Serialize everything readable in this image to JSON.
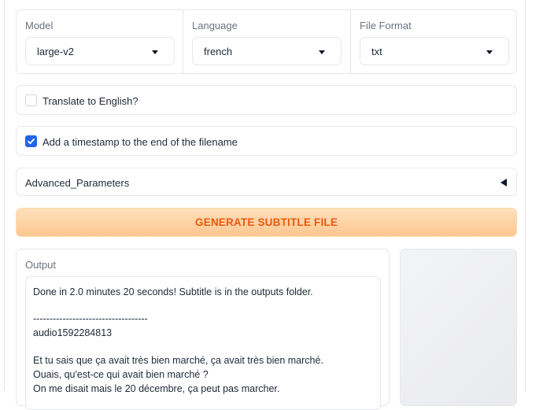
{
  "model": {
    "label": "Model",
    "value": "large-v2"
  },
  "language": {
    "label": "Language",
    "value": "french"
  },
  "file_format": {
    "label": "File Format",
    "value": "txt"
  },
  "translate": {
    "label": "Translate to English?",
    "checked": false
  },
  "timestamp": {
    "label": "Add a timestamp to the end of the filename",
    "checked": true
  },
  "advanced": {
    "label": "Advanced_Parameters"
  },
  "generate": {
    "label": "GENERATE SUBTITLE FILE"
  },
  "output": {
    "label": "Output",
    "lines": [
      "Done in 2.0 minutes 20 seconds! Subtitle is in the outputs folder.",
      "",
      "-----------------------------------",
      "audio1592284813",
      "",
      "Et tu sais que ça avait très bien marché, ça avait très bien marché.",
      "Ouais, qu'est-ce qui avait bien marché ?",
      "On me disait mais le 20 décembre, ça peut pas marcher."
    ]
  },
  "colors": {
    "accent": "#2563eb",
    "button_text": "#ea580c",
    "button_bg": "#fdc68f"
  }
}
